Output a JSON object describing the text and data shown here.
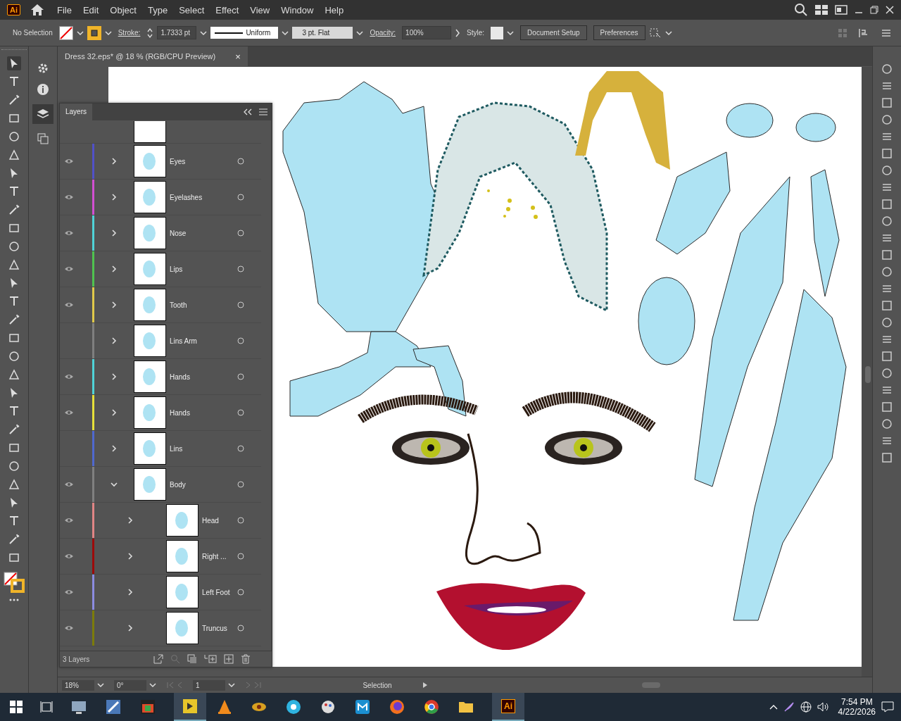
{
  "app": {
    "logo": "Ai",
    "menu": [
      "File",
      "Edit",
      "Object",
      "Type",
      "Select",
      "Effect",
      "View",
      "Window",
      "Help"
    ]
  },
  "control_bar": {
    "selection": "No Selection",
    "stroke_label": "Stroke:",
    "stroke_value": "1.7333 pt",
    "stroke_profile": "Uniform",
    "brush": "3 pt. Flat",
    "opacity_label": "Opacity:",
    "opacity": "100%",
    "style_label": "Style:",
    "buttons": [
      "Document Setup",
      "Preferences"
    ]
  },
  "document_tab": {
    "title": "Dress 32.eps* @ 18 % (RGB/CPU Preview)",
    "close": "×"
  },
  "layers_panel": {
    "title": "Layers",
    "layers": [
      {
        "name": "Eyes",
        "visible": true,
        "color": "#5151c8",
        "expanded": false
      },
      {
        "name": "Eyelashes",
        "visible": true,
        "color": "#d24fd2",
        "expanded": false
      },
      {
        "name": "Nose",
        "visible": true,
        "color": "#4fd3d8",
        "expanded": false
      },
      {
        "name": "Lips",
        "visible": true,
        "color": "#4fc34f",
        "expanded": false
      },
      {
        "name": "Tooth",
        "visible": true,
        "color": "#e0c94a",
        "expanded": false
      },
      {
        "name": "Lins Arm",
        "visible": false,
        "color": "#7f7f7f",
        "expanded": false
      },
      {
        "name": "Hands",
        "visible": true,
        "color": "#4fd3d8",
        "expanded": false
      },
      {
        "name": "Hands",
        "visible": true,
        "color": "#e6e03a",
        "expanded": false
      },
      {
        "name": "Lins",
        "visible": false,
        "color": "#4f68cf",
        "expanded": false
      },
      {
        "name": "Body",
        "visible": true,
        "color": "#808080",
        "expanded": true,
        "children": [
          {
            "name": "Head",
            "visible": true,
            "color": "#e08585",
            "expanded": false
          },
          {
            "name": "Right ...",
            "visible": true,
            "color": "#9c0a0a",
            "expanded": false
          },
          {
            "name": "Left Foot",
            "visible": true,
            "color": "#8c8ce0",
            "expanded": false
          },
          {
            "name": "Truncus",
            "visible": true,
            "color": "#7c7c0a",
            "expanded": false
          }
        ]
      }
    ],
    "footer": "3 Layers"
  },
  "status_bar": {
    "zoom": "18%",
    "rotation": "0°",
    "artboard": "1",
    "tool": "Selection"
  },
  "taskbar": {
    "app_label": "Ai",
    "time": "7:54 PM",
    "date": "4/22/2026"
  }
}
